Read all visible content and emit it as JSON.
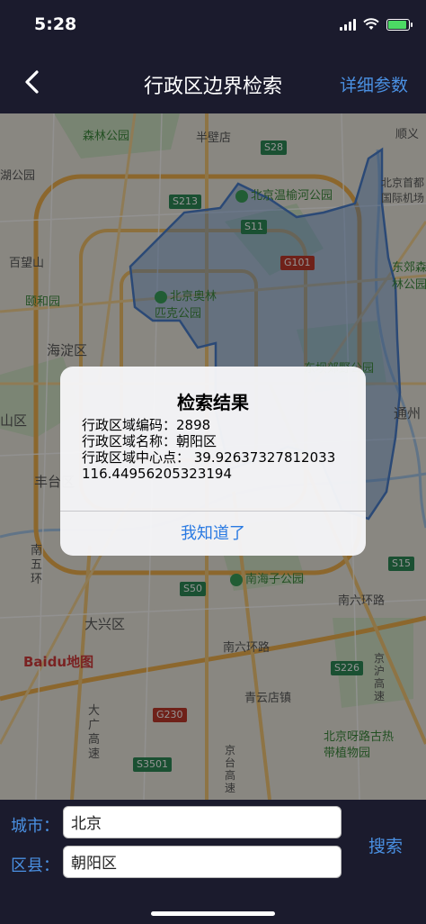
{
  "status": {
    "time": "5:28"
  },
  "nav": {
    "title": "行政区边界检索",
    "right_label": "详细参数",
    "back_icon": "chevron-left-icon"
  },
  "map": {
    "labels": [
      "森林公园",
      "半壁店",
      "丰台",
      "北京温榆河公园",
      "北京首都国际机场",
      "百望山",
      "颐和园",
      "北京奥林匹克公园",
      "东郊森林公园",
      "海淀区",
      "东坝郊野公园",
      "通州",
      "山区",
      "丰台区",
      "南五环",
      "南海子公园",
      "南六环路",
      "大兴区",
      "南六环路",
      "青云店镇",
      "北京呀路古热带植物园",
      "大广高速",
      "京台高速",
      "京沪高速",
      "顺义",
      "湖公园"
    ],
    "road_badges": [
      "S28",
      "S213",
      "S11",
      "G101",
      "S15",
      "S50",
      "S226",
      "G230",
      "S3501"
    ],
    "watermark": "Baidu地图",
    "boundary_color": "#5b8fd6"
  },
  "dialog": {
    "title": "检索结果",
    "line1": "行政区域编码：2898",
    "line2": "行政区域名称：朝阳区",
    "line3": "行政区域中心点：  39.92637327812033",
    "line4": "116.44956205323194",
    "button": "我知道了"
  },
  "form": {
    "city_label": "城市：",
    "city_value": "北京",
    "district_label": "区县：",
    "district_value": "朝阳区",
    "search_label": "搜索"
  },
  "colors": {
    "accent": "#4a90e2",
    "bar_bg": "#1b1b2d",
    "battery": "#4cd964"
  }
}
